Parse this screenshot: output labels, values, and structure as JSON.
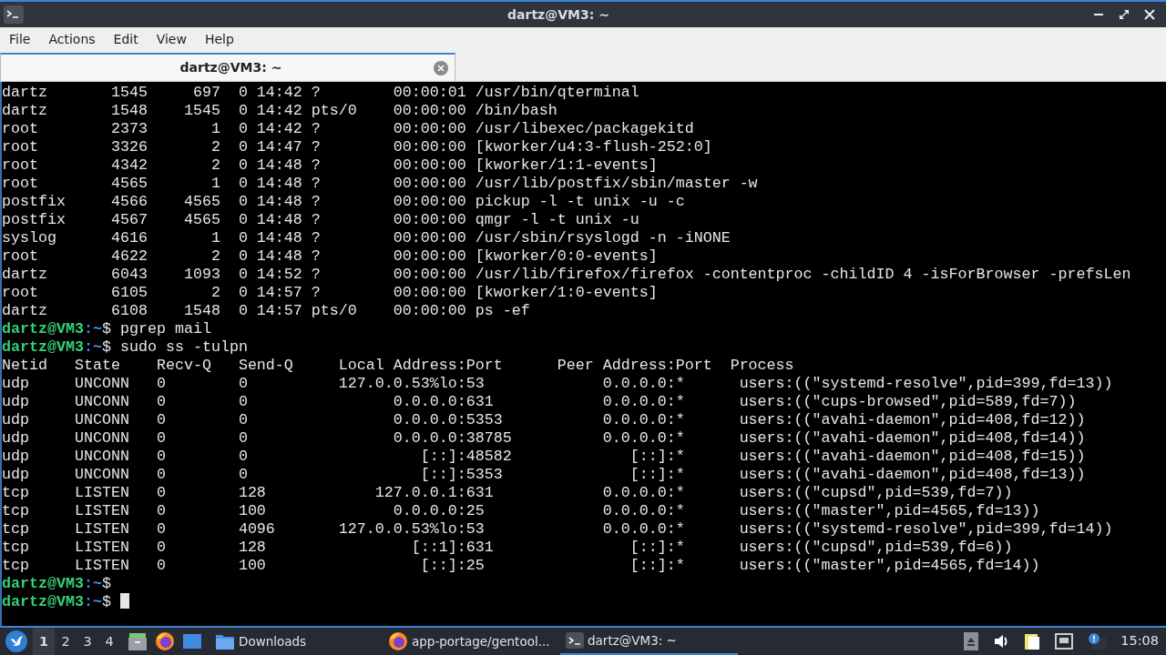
{
  "window": {
    "title": "dartz@VM3: ~"
  },
  "menu": [
    {
      "label": "File"
    },
    {
      "label": "Actions"
    },
    {
      "label": "Edit"
    },
    {
      "label": "View"
    },
    {
      "label": "Help"
    }
  ],
  "tabs": [
    {
      "label": "dartz@VM3: ~",
      "selected": true
    }
  ],
  "terminal": {
    "lines": [
      {
        "kind": "output",
        "text": "dartz       1545     697  0 14:42 ?        00:00:01 /usr/bin/qterminal"
      },
      {
        "kind": "output",
        "text": "dartz       1548    1545  0 14:42 pts/0    00:00:00 /bin/bash"
      },
      {
        "kind": "output",
        "text": "root        2373       1  0 14:42 ?        00:00:00 /usr/libexec/packagekitd"
      },
      {
        "kind": "output",
        "text": "root        3326       2  0 14:47 ?        00:00:00 [kworker/u4:3-flush-252:0]"
      },
      {
        "kind": "output",
        "text": "root        4342       2  0 14:48 ?        00:00:00 [kworker/1:1-events]"
      },
      {
        "kind": "output",
        "text": "root        4565       1  0 14:48 ?        00:00:00 /usr/lib/postfix/sbin/master -w"
      },
      {
        "kind": "output",
        "text": "postfix     4566    4565  0 14:48 ?        00:00:00 pickup -l -t unix -u -c"
      },
      {
        "kind": "output",
        "text": "postfix     4567    4565  0 14:48 ?        00:00:00 qmgr -l -t unix -u"
      },
      {
        "kind": "output",
        "text": "syslog      4616       1  0 14:48 ?        00:00:00 /usr/sbin/rsyslogd -n -iNONE"
      },
      {
        "kind": "output",
        "text": "root        4622       2  0 14:48 ?        00:00:00 [kworker/0:0-events]"
      },
      {
        "kind": "output",
        "text": "dartz       6043    1093  0 14:52 ?        00:00:00 /usr/lib/firefox/firefox -contentproc -childID 4 -isForBrowser -prefsLen"
      },
      {
        "kind": "output",
        "text": "root        6105       2  0 14:57 ?        00:00:00 [kworker/1:0-events]"
      },
      {
        "kind": "output",
        "text": "dartz       6108    1548  0 14:57 pts/0    00:00:00 ps -ef"
      },
      {
        "kind": "prompt",
        "user_host": "dartz@VM3",
        "path": ":~",
        "symbol": "$",
        "command": "pgrep mail"
      },
      {
        "kind": "prompt",
        "user_host": "dartz@VM3",
        "path": ":~",
        "symbol": "$",
        "command": "sudo ss -tulpn"
      },
      {
        "kind": "output",
        "text": "Netid   State    Recv-Q   Send-Q     Local Address:Port      Peer Address:Port  Process"
      },
      {
        "kind": "output",
        "text": "udp     UNCONN   0        0          127.0.0.53%lo:53             0.0.0.0:*      users:((\"systemd-resolve\",pid=399,fd=13))"
      },
      {
        "kind": "output",
        "text": "udp     UNCONN   0        0                0.0.0.0:631            0.0.0.0:*      users:((\"cups-browsed\",pid=589,fd=7))"
      },
      {
        "kind": "output",
        "text": "udp     UNCONN   0        0                0.0.0.0:5353           0.0.0.0:*      users:((\"avahi-daemon\",pid=408,fd=12))"
      },
      {
        "kind": "output",
        "text": "udp     UNCONN   0        0                0.0.0.0:38785          0.0.0.0:*      users:((\"avahi-daemon\",pid=408,fd=14))"
      },
      {
        "kind": "output",
        "text": "udp     UNCONN   0        0                   [::]:48582             [::]:*      users:((\"avahi-daemon\",pid=408,fd=15))"
      },
      {
        "kind": "output",
        "text": "udp     UNCONN   0        0                   [::]:5353              [::]:*      users:((\"avahi-daemon\",pid=408,fd=13))"
      },
      {
        "kind": "output",
        "text": "tcp     LISTEN   0        128            127.0.0.1:631            0.0.0.0:*      users:((\"cupsd\",pid=539,fd=7))"
      },
      {
        "kind": "output",
        "text": "tcp     LISTEN   0        100              0.0.0.0:25             0.0.0.0:*      users:((\"master\",pid=4565,fd=13))"
      },
      {
        "kind": "output",
        "text": "tcp     LISTEN   0        4096       127.0.0.53%lo:53             0.0.0.0:*      users:((\"systemd-resolve\",pid=399,fd=14))"
      },
      {
        "kind": "output",
        "text": "tcp     LISTEN   0        128                [::1]:631               [::]:*      users:((\"cupsd\",pid=539,fd=6))"
      },
      {
        "kind": "output",
        "text": "tcp     LISTEN   0        100                 [::]:25                [::]:*      users:((\"master\",pid=4565,fd=14))"
      },
      {
        "kind": "prompt",
        "user_host": "dartz@VM3",
        "path": ":~",
        "symbol": "$"
      },
      {
        "kind": "prompt",
        "user_host": "dartz@VM3",
        "path": ":~",
        "symbol": "$",
        "cursor": true
      }
    ]
  },
  "taskbar": {
    "desktops": [
      {
        "label": "1",
        "selected": true
      },
      {
        "label": "2",
        "selected": false
      },
      {
        "label": "3",
        "selected": false
      },
      {
        "label": "4",
        "selected": false
      }
    ],
    "launchers": [
      {
        "kind": "files"
      },
      {
        "kind": "firefox"
      },
      {
        "kind": "desktop"
      }
    ],
    "tasks": [
      {
        "kind": "folder",
        "label": "Downloads",
        "selected": false
      },
      {
        "kind": "firefox",
        "label": "app-portage/gentool...",
        "selected": false
      },
      {
        "kind": "terminal",
        "label": "dartz@VM3: ~",
        "selected": true
      }
    ],
    "clock": "15:08"
  }
}
